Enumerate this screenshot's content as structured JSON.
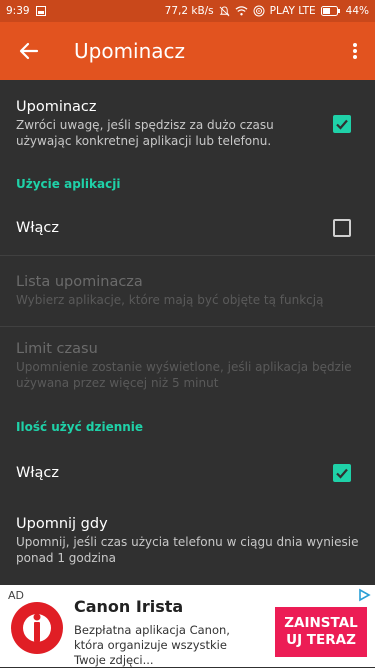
{
  "statusbar": {
    "time": "9:39",
    "speed": "77,2 kB/s",
    "carrier": "PLAY LTE",
    "battery": "44%"
  },
  "appbar": {
    "title": "Upominacz"
  },
  "settings": {
    "main": {
      "title": "Upominacz",
      "summary": "Zwróci uwagę, jeśli spędzisz za dużo czasu używając konkretnej aplikacji lub telefonu.",
      "checked": true
    },
    "app_usage_header": "Użycie aplikacji",
    "app_enable": {
      "title": "Włącz",
      "checked": false
    },
    "reminder_list": {
      "title": "Lista upominacza",
      "summary": "Wybierz aplikacje, które mają być objęte tą funkcją"
    },
    "time_limit": {
      "title": "Limit czasu",
      "summary": "Upomnienie zostanie wyświetlone, jeśli aplikacja będzie używana przez więcej niż 5 minut"
    },
    "daily_uses_header": "Ilość użyć dziennie",
    "daily_enable": {
      "title": "Włącz",
      "checked": true
    },
    "remind_when": {
      "title": "Upomnij gdy",
      "summary": "Upomnij, jeśli czas użycia telefonu w ciągu dnia wyniesie ponad 1 godzina"
    }
  },
  "ad": {
    "badge": "AD",
    "title": "Canon Irista",
    "description": "Bezpłatna aplikacja Canon, która organizuje wszystkie Twoje zdjęci...",
    "cta": "ZAINSTALUJ TERAZ",
    "cta_line1": "ZAINSTAL",
    "cta_line2": "UJ TERAZ"
  },
  "colors": {
    "appbar": "#e2531f",
    "statusbar": "#c9481b",
    "accent": "#1fd1a8",
    "background": "#303030",
    "cta": "#ec1d55"
  }
}
